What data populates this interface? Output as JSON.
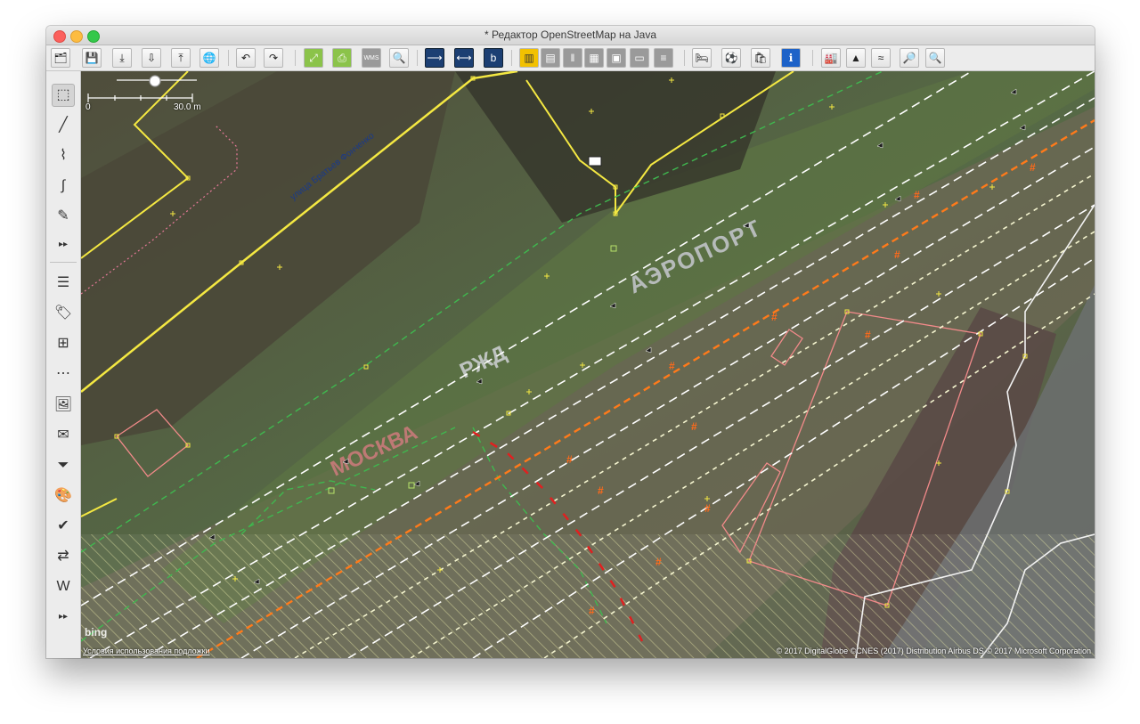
{
  "window": {
    "title": "* Редактор OpenStreetMap на Java"
  },
  "toolbar": {
    "buttons": [
      {
        "name": "open-file-button",
        "glyph": "🗂"
      },
      {
        "name": "save-button",
        "glyph": "💾"
      },
      {
        "name": "download-button",
        "glyph": "⤓"
      },
      {
        "name": "download-object-button",
        "glyph": "⇩"
      },
      {
        "name": "upload-button",
        "glyph": "⤒"
      },
      {
        "name": "preferences-globe-button",
        "glyph": "🌐"
      },
      {
        "name": "undo-button",
        "glyph": "↶"
      },
      {
        "name": "redo-button",
        "glyph": "↷"
      },
      {
        "name": "zoom-to-data-button",
        "glyph": "⤢"
      },
      {
        "name": "print-button",
        "glyph": "⎙"
      },
      {
        "name": "wms-tms-button",
        "glyph": "WMS"
      },
      {
        "name": "zoom-search-button",
        "glyph": "🔍"
      },
      {
        "name": "split-way-button",
        "glyph": "⟶"
      },
      {
        "name": "combine-way-button",
        "glyph": "⟷"
      },
      {
        "name": "bing-imagery-button",
        "glyph": "b"
      },
      {
        "name": "railway-preset-button",
        "glyph": "▥"
      },
      {
        "name": "rail-abandoned-button",
        "glyph": "▤"
      },
      {
        "name": "rail-narrow-button",
        "glyph": "‖"
      },
      {
        "name": "rail-disused-button",
        "glyph": "▦"
      },
      {
        "name": "level-crossing-button",
        "glyph": "▣"
      },
      {
        "name": "platform-button",
        "glyph": "▭"
      },
      {
        "name": "railway-track-button",
        "glyph": "≡"
      },
      {
        "name": "hotel-button",
        "glyph": "🛏"
      },
      {
        "name": "sport-button",
        "glyph": "⚽"
      },
      {
        "name": "shop-button",
        "glyph": "🛍"
      },
      {
        "name": "info-button",
        "glyph": "ℹ"
      },
      {
        "name": "industrial-button",
        "glyph": "🏭"
      },
      {
        "name": "peak-button",
        "glyph": "▲"
      },
      {
        "name": "waterway-button",
        "glyph": "≈"
      },
      {
        "name": "search-overpass-button",
        "glyph": "🔎"
      },
      {
        "name": "search-tag-button",
        "glyph": "🔍"
      }
    ]
  },
  "lefttools": [
    {
      "name": "select-tool",
      "glyph": "⬚",
      "selected": true
    },
    {
      "name": "draw-line-tool",
      "glyph": "╱"
    },
    {
      "name": "improve-way-tool",
      "glyph": "⌇"
    },
    {
      "name": "draw-curve-tool",
      "glyph": "∫"
    },
    {
      "name": "freehand-pencil-tool",
      "glyph": "✎"
    },
    {
      "name": "more-tools-button",
      "glyph": "▸▸"
    },
    {
      "name": "layers-toggle",
      "glyph": "☰"
    },
    {
      "name": "tags-toggle",
      "glyph": "🏷"
    },
    {
      "name": "relation-toggle",
      "glyph": "⊞"
    },
    {
      "name": "selection-list-toggle",
      "glyph": "⋯"
    },
    {
      "name": "imagery-toggle",
      "glyph": "🖼"
    },
    {
      "name": "messages-toggle",
      "glyph": "✉"
    },
    {
      "name": "filter-toggle",
      "glyph": "⏷"
    },
    {
      "name": "map-paint-toggle",
      "glyph": "🎨"
    },
    {
      "name": "validator-toggle",
      "glyph": "✔"
    },
    {
      "name": "changeset-toggle",
      "glyph": "⇄"
    },
    {
      "name": "wikipedia-toggle",
      "glyph": "W"
    },
    {
      "name": "more-panels-button",
      "glyph": "▸▸"
    }
  ],
  "map": {
    "scale": {
      "min": "0",
      "max": "30.0 m"
    },
    "street_label": "улица Братьев Фонченко",
    "ground_text": [
      "АЭРОПОРТ",
      "РЖД",
      "МОСКВА"
    ],
    "bing_logo": "bing",
    "terms_link": "Условия использования подложки",
    "copyright": "© 2017 DigitalGlobe ©CNES (2017) Distribution Airbus DS © 2017 Microsoft Corporation",
    "colors": {
      "building_outline": "#f28a8a",
      "road_yellow": "#f4e842",
      "rail_white": "#ffffff",
      "rail_orange": "#ff7a1a",
      "path_green": "#3fb84f",
      "hatch": "#e6e6a0"
    }
  }
}
